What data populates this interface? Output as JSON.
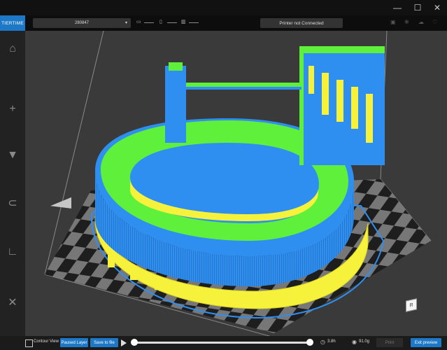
{
  "app": {
    "logo": "TIERTIME"
  },
  "window": {
    "minimize": "—",
    "maximize": "☐",
    "close": "✕"
  },
  "toolbar": {
    "model_select": "280847",
    "model_caret": "▾",
    "printer_status": "Printer not Connected"
  },
  "bottom": {
    "contour_view": "Contour View",
    "paused_layer": "Paused Layer",
    "save_to_file": "Save to file",
    "print_time": "3.8h",
    "weight": "91.0g",
    "print": "Print",
    "exit_preview": "Exit preview",
    "layer_slider": {
      "start_fraction": 0.0,
      "end_fraction": 1.0
    }
  },
  "view_cube_label": "R",
  "colors": {
    "accent": "#1d78c7",
    "model_blue": "#2f8ff0",
    "model_green": "#5ff03c",
    "model_yellow": "#f6f13a",
    "viewport_bg": "#3a3a3a"
  },
  "icons": {
    "sidebar": [
      "home-icon",
      "add-icon",
      "print-bed-icon",
      "magnet-icon",
      "ruler-icon",
      "wrench-icon"
    ],
    "top_right": [
      "lock-icon",
      "settings-icon",
      "cloud-icon",
      "heart-icon"
    ]
  }
}
